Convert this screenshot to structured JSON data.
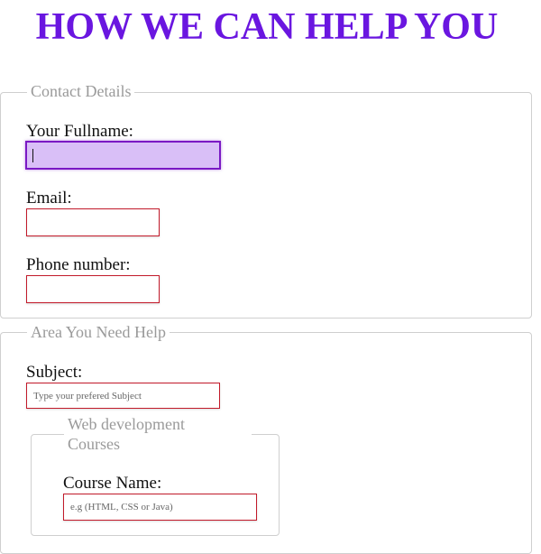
{
  "page": {
    "title": "HOW WE CAN HELP YOU"
  },
  "contact_details": {
    "legend": "Contact Details",
    "fullname": {
      "label": "Your Fullname:",
      "value": "",
      "placeholder": ""
    },
    "email": {
      "label": "Email:",
      "value": "",
      "placeholder": ""
    },
    "phone": {
      "label": "Phone number:",
      "value": "",
      "placeholder": ""
    }
  },
  "help_area": {
    "legend": "Area You Need Help",
    "subject": {
      "label": "Subject:",
      "value": "",
      "placeholder": "Type your prefered Subject"
    },
    "web_dev": {
      "legend_line1": "Web development",
      "legend_line2": "Courses",
      "course_name": {
        "label": "Course Name:",
        "value": "",
        "placeholder": "e.g (HTML, CSS or Java)"
      }
    }
  },
  "colors": {
    "title": "#6a16e0",
    "input_border": "#c21a2a",
    "focused_input_bg": "#d9bff7",
    "focused_input_border": "#7a19c4"
  }
}
